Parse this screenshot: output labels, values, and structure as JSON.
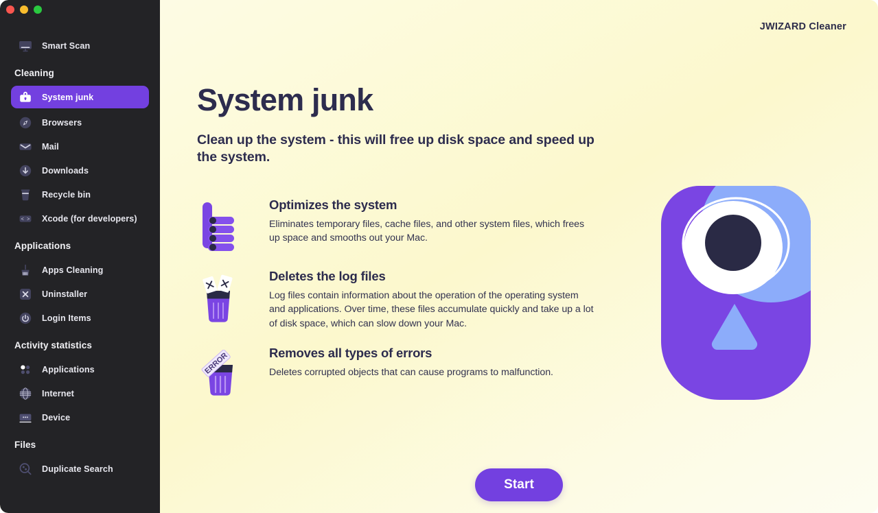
{
  "window": {
    "traffic_lights": [
      {
        "name": "close",
        "color": "#f9564f"
      },
      {
        "name": "minimize",
        "color": "#f9bd2e"
      },
      {
        "name": "maximize",
        "color": "#2ac940"
      }
    ]
  },
  "brand": {
    "title": "JWIZARD Cleaner"
  },
  "sidebar": {
    "top_item": {
      "label": "Smart Scan",
      "icon": "monitor-icon"
    },
    "groups": [
      {
        "label": "Cleaning",
        "items": [
          {
            "label": "System junk",
            "icon": "toolbox-icon",
            "active": true
          },
          {
            "label": "Browsers",
            "icon": "compass-icon",
            "active": false
          },
          {
            "label": "Mail",
            "icon": "envelope-icon",
            "active": false
          },
          {
            "label": "Downloads",
            "icon": "download-arrow-icon",
            "active": false
          },
          {
            "label": "Recycle bin",
            "icon": "trash-icon",
            "active": false
          },
          {
            "label": "Xcode (for developers)",
            "icon": "code-brackets-icon",
            "active": false
          }
        ]
      },
      {
        "label": "Applications",
        "items": [
          {
            "label": "Apps Cleaning",
            "icon": "broom-icon",
            "active": false
          },
          {
            "label": "Uninstaller",
            "icon": "x-square-icon",
            "active": false
          },
          {
            "label": "Login Items",
            "icon": "power-icon",
            "active": false
          }
        ]
      },
      {
        "label": "Activity statistics",
        "items": [
          {
            "label": "Applications",
            "icon": "dots-grid-icon",
            "active": false
          },
          {
            "label": "Internet",
            "icon": "globe-icon",
            "active": false
          },
          {
            "label": "Device",
            "icon": "device-icon",
            "active": false
          }
        ]
      },
      {
        "label": "Files",
        "items": [
          {
            "label": "Duplicate Search",
            "icon": "magnifier-shapes-icon",
            "active": false
          }
        ]
      }
    ]
  },
  "main": {
    "title": "System junk",
    "subtitle": "Clean up the system - this will free up disk space and speed up the system.",
    "features": [
      {
        "icon": "thumbs-up-icon",
        "title": "Optimizes the system",
        "description": "Eliminates temporary files, cache files, and other system files, which frees up space and smooths out your Mac."
      },
      {
        "icon": "trash-papers-icon",
        "title": "Deletes the log files",
        "description": "Log files contain information about the operation of the operating system and applications. Over time, these files accumulate quickly and take up a lot of disk space, which can slow down your Mac."
      },
      {
        "icon": "trash-error-icon",
        "title": "Removes all types of errors",
        "description": "Deletes corrupted objects that can cause programs to malfunction."
      }
    ],
    "illustration": {
      "name": "eye-robot-illustration",
      "error_label": "ERROR"
    },
    "start_button": "Start"
  },
  "colors": {
    "accent_purple": "#7340e0",
    "sidebar_bg": "#232326",
    "text_dark": "#2d2c4e",
    "page_bg_light": "#fdfbe9",
    "page_bg_yellow": "#fcf8cd",
    "light_blue": "#8cacfa"
  }
}
